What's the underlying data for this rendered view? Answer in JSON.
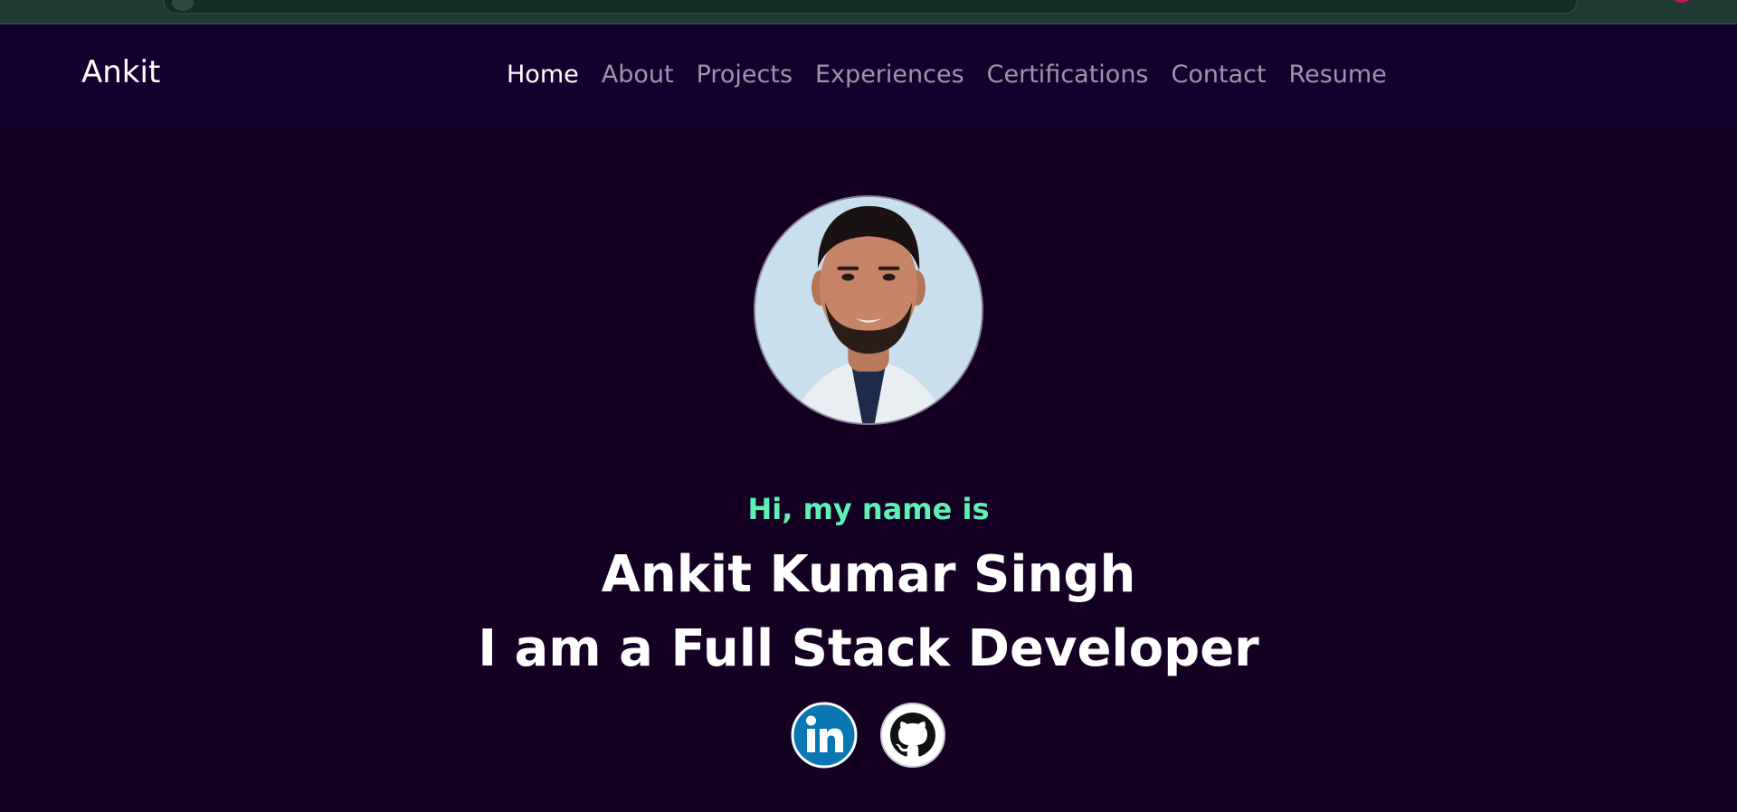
{
  "nav": {
    "brand": "Ankit",
    "links": [
      {
        "label": "Home",
        "active": true
      },
      {
        "label": "About",
        "active": false
      },
      {
        "label": "Projects",
        "active": false
      },
      {
        "label": "Experiences",
        "active": false
      },
      {
        "label": "Certifications",
        "active": false
      },
      {
        "label": "Contact",
        "active": false
      },
      {
        "label": "Resume",
        "active": false
      }
    ]
  },
  "hero": {
    "greeting": "Hi, my name is",
    "name": "Ankit Kumar Singh",
    "role": "I am a Full Stack Developer",
    "social": [
      {
        "icon": "linkedin-icon"
      },
      {
        "icon": "github-icon"
      }
    ]
  },
  "colors": {
    "background": "#130022",
    "navbar": "#14002e",
    "accent": "#5ef0b4",
    "nav_inactive": "#9e95aa",
    "nav_active": "#ffffff",
    "linkedin": "#0a77b5"
  }
}
